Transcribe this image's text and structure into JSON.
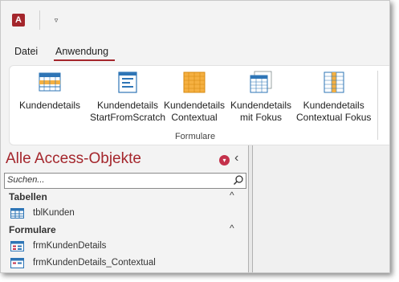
{
  "titlebar": {
    "app_icon": "access-app-icon",
    "app_icon_letter": "A",
    "qat_customize_icon": "chevron-down-icon",
    "qat_glyph": "▿"
  },
  "tabs": [
    {
      "label": "Datei",
      "active": false
    },
    {
      "label": "Anwendung",
      "active": true
    }
  ],
  "ribbon": {
    "group_label": "Formulare",
    "buttons": [
      {
        "line1": "Kundendetails",
        "line2": "",
        "icon": "form-details-icon"
      },
      {
        "line1": "Kundendetails",
        "line2": "StartFromScratch",
        "icon": "form-scratch-icon"
      },
      {
        "line1": "Kundendetails",
        "line2": "Contextual",
        "icon": "form-contextual-icon"
      },
      {
        "line1": "Kundendetails",
        "line2": "mit Fokus",
        "icon": "form-focus-icon"
      },
      {
        "line1": "Kundendetails",
        "line2": "Contextual Fokus",
        "icon": "form-contextual-focus-icon"
      }
    ]
  },
  "nav": {
    "title": "Alle Access-Objekte",
    "menu_icon": "dropdown-circle-icon",
    "collapse_icon": "chevron-left-icon",
    "collapse_glyph": "‹",
    "search_placeholder": "Suchen...",
    "search_icon": "search-icon",
    "sections": [
      {
        "label": "Tabellen",
        "chevron": "^",
        "items": [
          {
            "label": "tblKunden",
            "icon": "table-icon"
          }
        ]
      },
      {
        "label": "Formulare",
        "chevron": "^",
        "items": [
          {
            "label": "frmKundenDetails",
            "icon": "form-icon"
          },
          {
            "label": "frmKundenDetails_Contextual",
            "icon": "form-icon"
          }
        ]
      }
    ]
  },
  "colors": {
    "accent": "#a4262c",
    "ribbon_bg": "#ffffff",
    "chrome_bg": "#f3f3f3",
    "icon_blue": "#2e75b6",
    "icon_gold": "#f5b041"
  }
}
